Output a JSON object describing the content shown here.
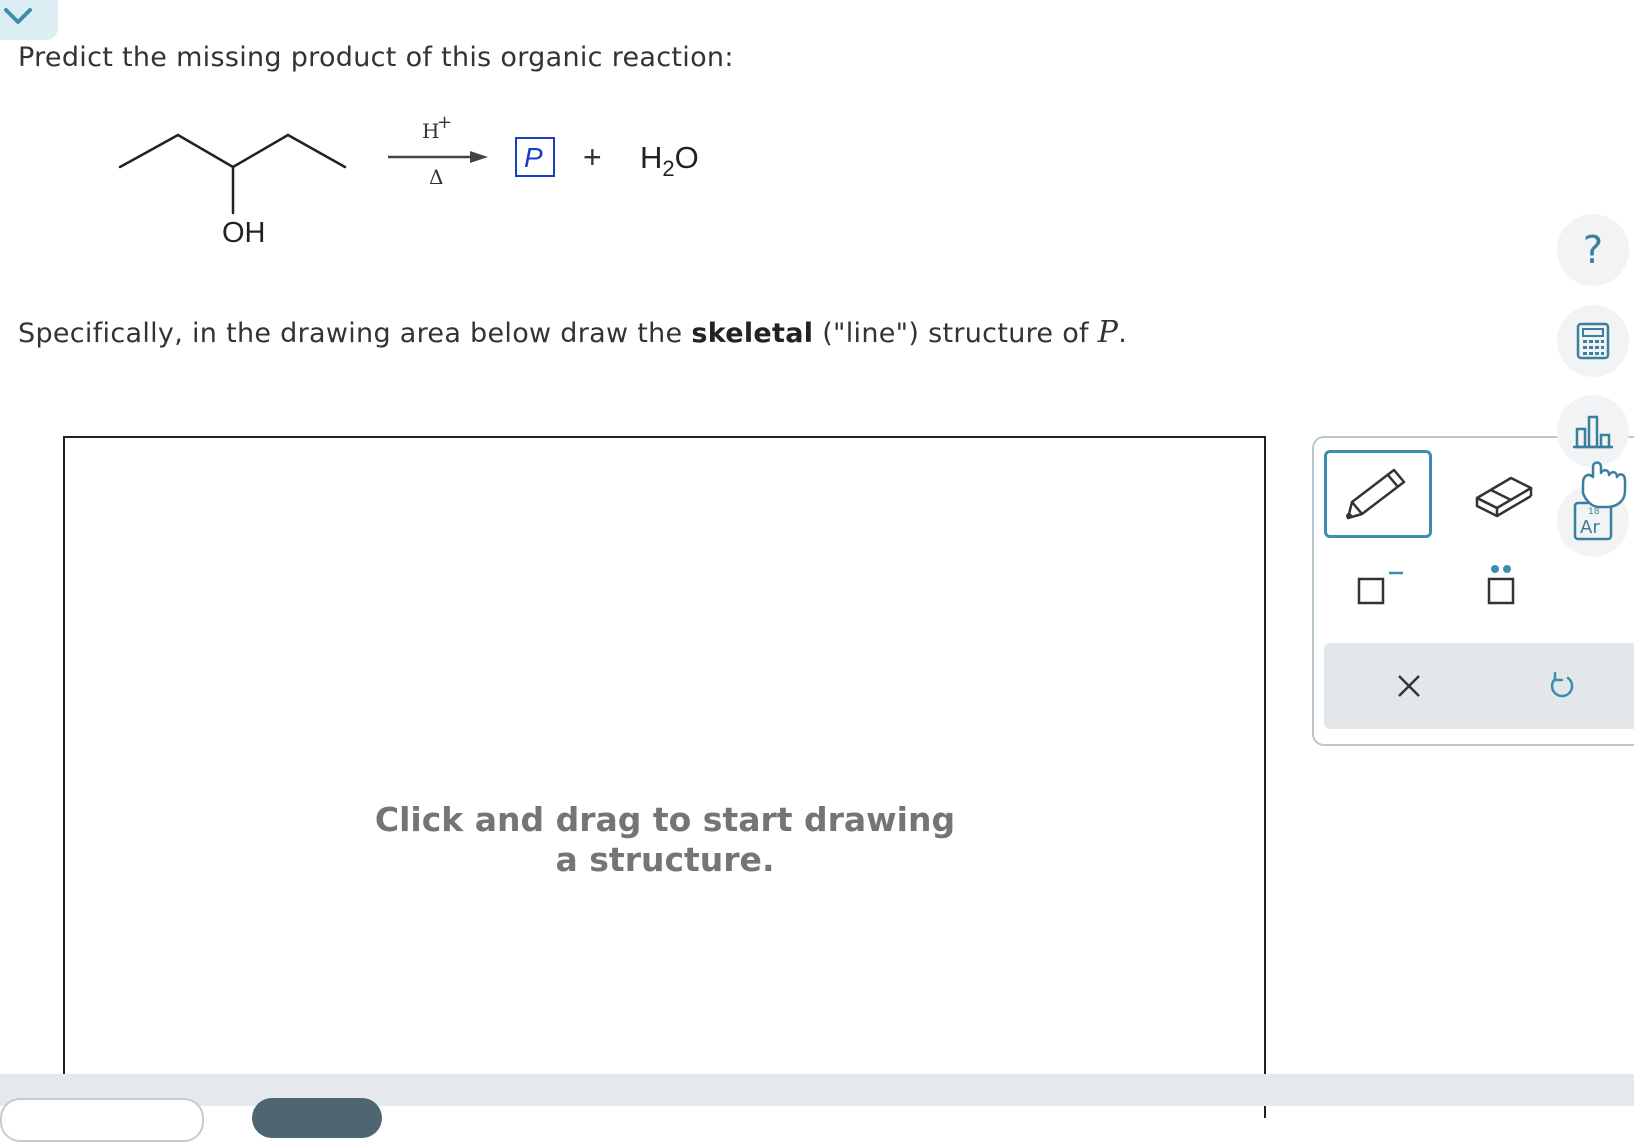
{
  "question": {
    "prompt": "Predict the missing product of this organic reaction:",
    "instructions_pre": "Specifically, in the drawing area below draw the ",
    "instructions_bold": "skeletal",
    "instructions_mid": " (\"line\") structure of ",
    "instructions_var": "P",
    "instructions_end": "."
  },
  "reaction": {
    "reactant_group": "OH",
    "reagent_above": "H",
    "reagent_charge": "+",
    "reagent_below": "Δ",
    "product_label": "P",
    "plus": "+",
    "byproduct_main": "H",
    "byproduct_sub": "2",
    "byproduct_end": "O"
  },
  "canvas": {
    "hint": "Click and drag to start drawing a structure."
  },
  "palette": {
    "selected_tool": "pencil",
    "tools": [
      "pencil-icon",
      "eraser-icon",
      "charge-icon",
      "lone-pair-icon"
    ],
    "actions": [
      "clear-icon",
      "undo-icon"
    ]
  },
  "side_tools": {
    "help_label": "?",
    "element_number": "18",
    "element_symbol": "Ar"
  },
  "colors": {
    "accent": "#3b8eb1",
    "product_box": "#1a3cc8",
    "panel_bg": "#e3e7ea"
  }
}
